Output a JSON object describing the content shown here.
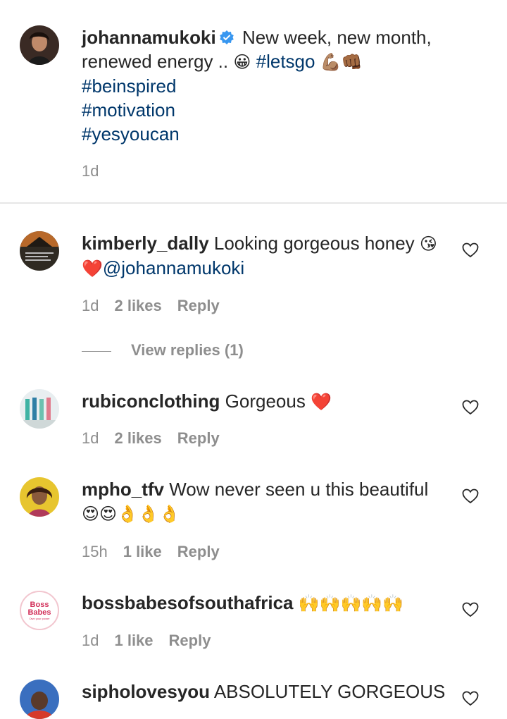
{
  "caption": {
    "username": "johannamukoki",
    "text_line1": "New week, new month,",
    "text_line2a": "renewed energy ..",
    "emoji_smile": "😀",
    "tag_letsgo": "#letsgo",
    "emoji_muscle_fist": "💪🏽👊🏾",
    "tag_beinspired": "#beinspired",
    "tag_motivation": "#motivation",
    "tag_yesyoucan": "#yesyoucan",
    "time": "1d"
  },
  "comments": [
    {
      "username": "kimberly_dally",
      "text": "Looking gorgeous honey",
      "emoji": "😘",
      "line2_emoji": "❤️",
      "mention": "@johannamukoki",
      "time": "1d",
      "likes": "2 likes",
      "reply": "Reply",
      "view_replies": "View replies (1)"
    },
    {
      "username": "rubiconclothing",
      "text": "Gorgeous",
      "emoji": "❤️",
      "time": "1d",
      "likes": "2 likes",
      "reply": "Reply"
    },
    {
      "username": "mpho_tfv",
      "text": "Wow never seen u this beautiful",
      "line2_emoji": "😍😍👌👌👌",
      "time": "15h",
      "likes": "1 like",
      "reply": "Reply"
    },
    {
      "username": "bossbabesofsouthafrica",
      "text": "",
      "emoji": "🙌🙌🙌🙌🙌",
      "avatar_text1": "Boss",
      "avatar_text2": "Babes",
      "avatar_sub": "Own your power",
      "time": "1d",
      "likes": "1 like",
      "reply": "Reply"
    },
    {
      "username": "sipholovesyou",
      "text": "ABSOLUTELY GORGEOUS"
    }
  ],
  "colors": {
    "link": "#00376b",
    "muted": "#8e8e8e",
    "verified": "#3897f0"
  },
  "icons": [
    "heart-outline-icon",
    "verified-badge-icon"
  ]
}
